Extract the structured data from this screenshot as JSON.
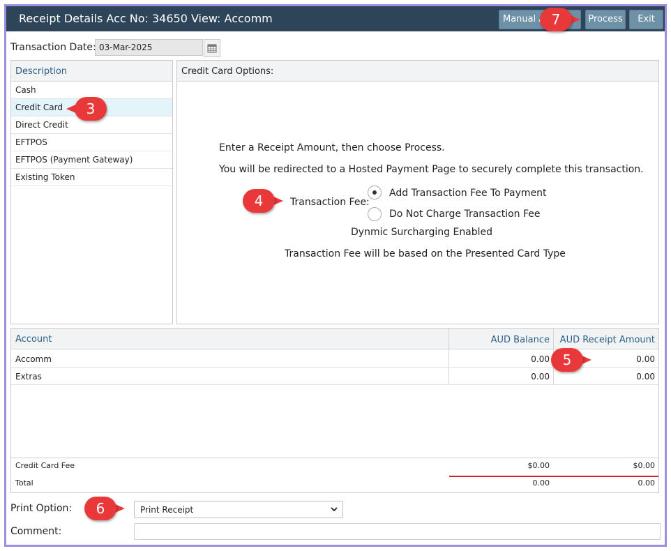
{
  "window": {
    "title": "Receipt Details Acc No: 34650 View: Accomm",
    "buttons": {
      "manual": "Manual A",
      "process": "Process",
      "exit": "Exit"
    }
  },
  "transaction_date": {
    "label": "Transaction Date:",
    "value": "03-Mar-2025"
  },
  "description": {
    "header": "Description",
    "items": [
      "Cash",
      "Credit Card",
      "Direct Credit",
      "EFTPOS",
      "EFTPOS (Payment Gateway)",
      "Existing Token"
    ],
    "selected": "Credit Card"
  },
  "credit_card_options": {
    "header": "Credit Card Options:",
    "line1": "Enter a Receipt Amount, then choose Process.",
    "line2": "You will be redirected to a Hosted Payment Page to securely complete this transaction.",
    "fee_label": "Transaction Fee:",
    "option_add": "Add Transaction Fee To Payment",
    "option_none": "Do Not Charge Transaction Fee",
    "selected_option": "Add Transaction Fee To Payment",
    "surcharge": "Dynmic Surcharging Enabled",
    "fee_note": "Transaction Fee will be based on the Presented Card Type"
  },
  "accounts": {
    "headers": {
      "account": "Account",
      "balance": "AUD Balance",
      "receipt": "AUD Receipt Amount"
    },
    "rows": [
      {
        "account": "Accomm",
        "balance": "0.00",
        "receipt": "0.00"
      },
      {
        "account": "Extras",
        "balance": "0.00",
        "receipt": "0.00"
      }
    ],
    "fee_row": {
      "label": "Credit Card Fee",
      "balance": "$0.00",
      "receipt": "$0.00"
    },
    "total_row": {
      "label": "Total",
      "balance": "0.00",
      "receipt": "0.00"
    }
  },
  "print_option": {
    "label": "Print Option:",
    "value": "Print Receipt"
  },
  "comment": {
    "label": "Comment:",
    "value": ""
  },
  "callouts": [
    "3",
    "4",
    "5",
    "6",
    "7"
  ],
  "colors": {
    "titlebar": "#2e4459",
    "button": "#6e91a8",
    "callout": "#e8383a",
    "border": "#9a8fe0",
    "selected_row": "#e4f4fb",
    "total_rule": "#d0232a"
  },
  "icons": {
    "calendar": "calendar-icon",
    "dropdown": "chevron-down-icon"
  }
}
